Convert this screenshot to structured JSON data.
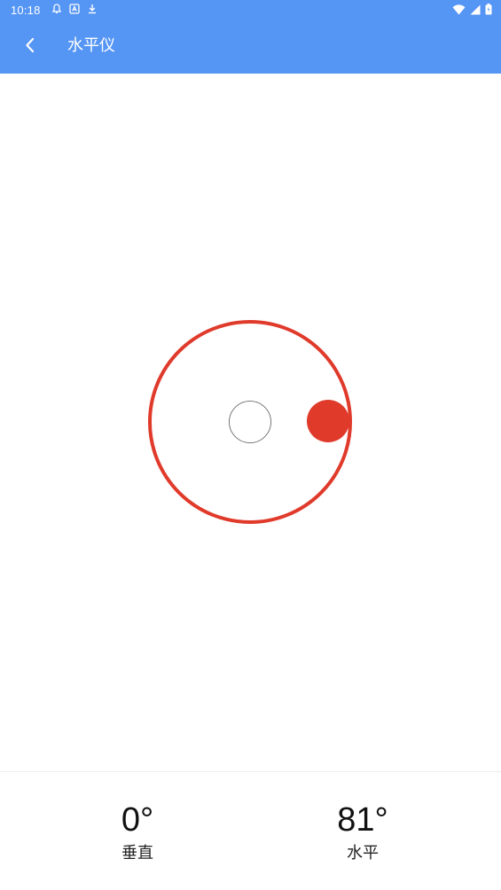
{
  "status_bar": {
    "time": "10:18",
    "left_icons": [
      "notification-bell-icon",
      "app-a-icon",
      "download-icon"
    ],
    "right_icons": [
      "wifi-icon",
      "signal-icon",
      "battery-icon"
    ]
  },
  "header": {
    "back_icon": "chevron-left-icon",
    "title": "水平仪",
    "background_color": "#5595f4"
  },
  "level": {
    "ring_color": "#e03a2b",
    "bubble_color": "#e03a2b",
    "center_marker": "hollow-circle",
    "bubble_position": "right-edge-of-ring"
  },
  "readings": {
    "vertical": {
      "value": "0°",
      "label": "垂直"
    },
    "horizontal": {
      "value": "81°",
      "label": "水平"
    }
  }
}
